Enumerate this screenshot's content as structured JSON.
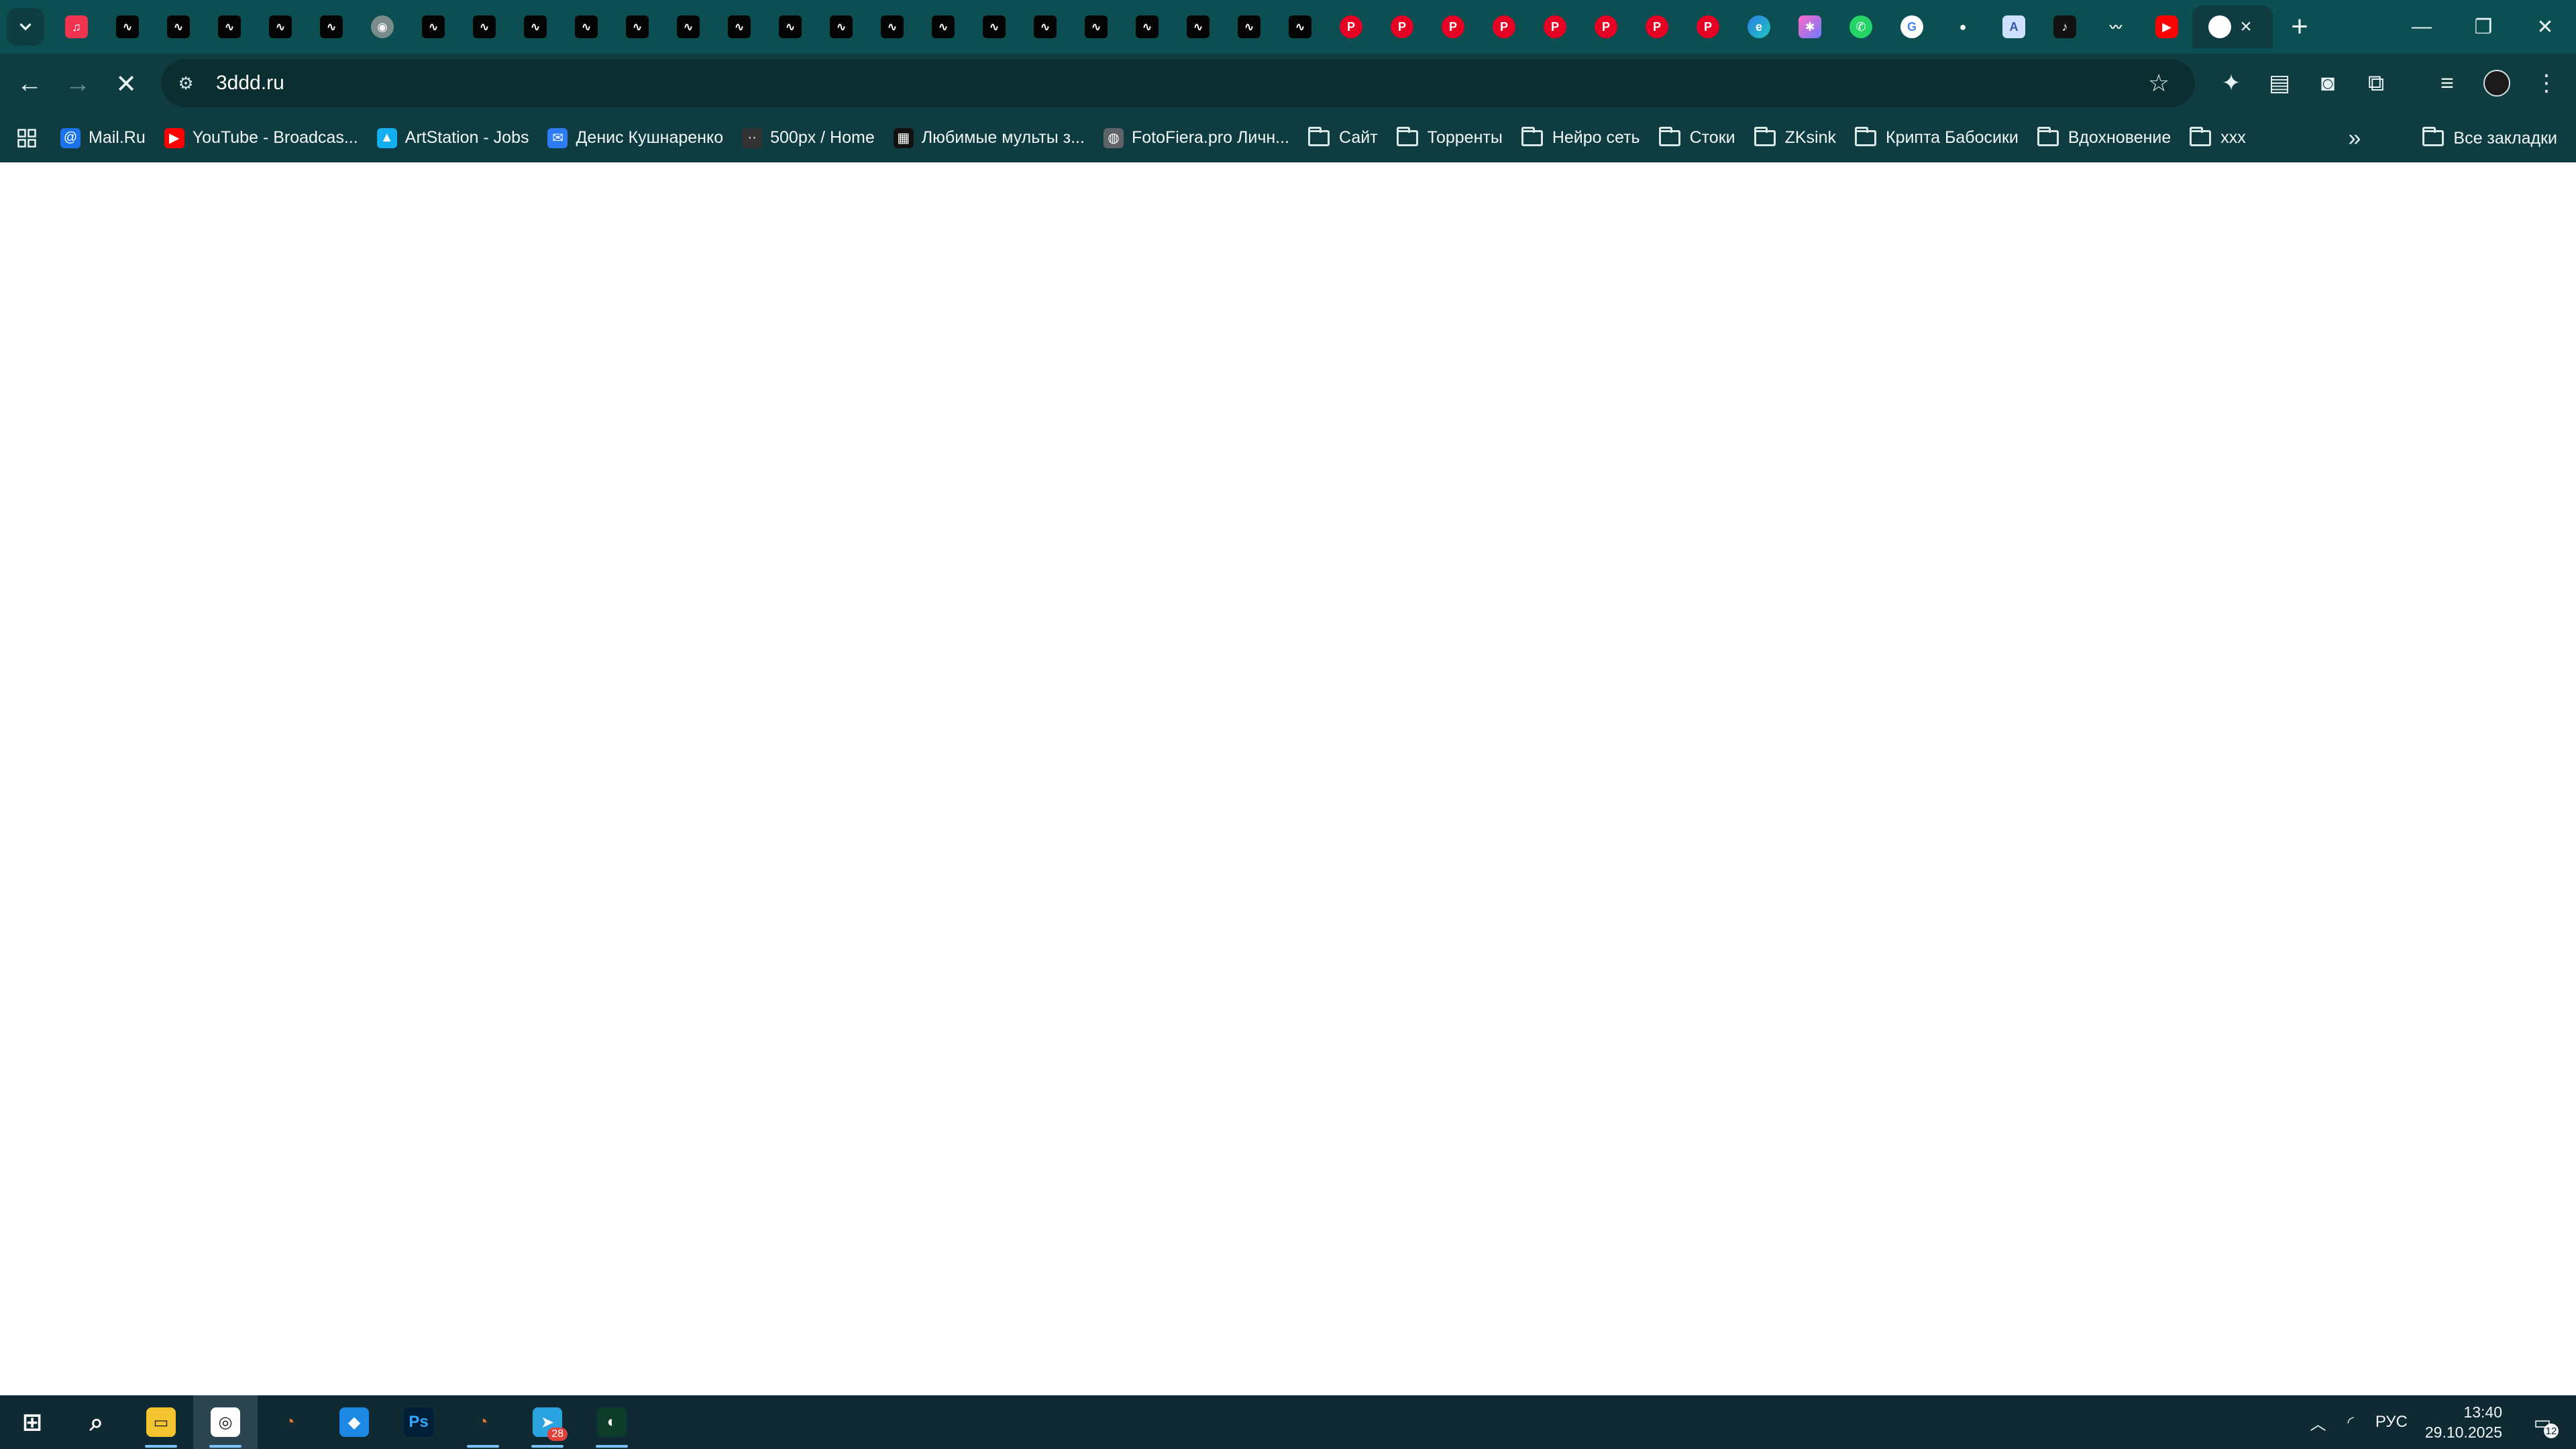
{
  "browser": {
    "tabs": [
      {
        "icon": "music-icon",
        "style": "music",
        "glyph": "♫"
      },
      {
        "icon": "site-icon",
        "style": "black",
        "glyph": "∿"
      },
      {
        "icon": "site-icon",
        "style": "black",
        "glyph": "∿"
      },
      {
        "icon": "site-icon",
        "style": "black",
        "glyph": "∿"
      },
      {
        "icon": "site-icon",
        "style": "black",
        "glyph": "∿"
      },
      {
        "icon": "site-icon",
        "style": "black",
        "glyph": "∿"
      },
      {
        "icon": "globe-icon",
        "style": "gray",
        "glyph": "◉"
      },
      {
        "icon": "site-icon",
        "style": "black",
        "glyph": "∿"
      },
      {
        "icon": "site-icon",
        "style": "black",
        "glyph": "∿"
      },
      {
        "icon": "site-icon",
        "style": "black",
        "glyph": "∿"
      },
      {
        "icon": "site-icon",
        "style": "black",
        "glyph": "∿"
      },
      {
        "icon": "site-icon",
        "style": "black",
        "glyph": "∿"
      },
      {
        "icon": "site-icon",
        "style": "black",
        "glyph": "∿"
      },
      {
        "icon": "site-icon",
        "style": "black",
        "glyph": "∿"
      },
      {
        "icon": "site-icon",
        "style": "black",
        "glyph": "∿"
      },
      {
        "icon": "site-icon",
        "style": "black",
        "glyph": "∿"
      },
      {
        "icon": "site-icon",
        "style": "black",
        "glyph": "∿"
      },
      {
        "icon": "site-icon",
        "style": "black",
        "glyph": "∿"
      },
      {
        "icon": "site-icon",
        "style": "black",
        "glyph": "∿"
      },
      {
        "icon": "site-icon",
        "style": "black",
        "glyph": "∿"
      },
      {
        "icon": "site-icon",
        "style": "black",
        "glyph": "∿"
      },
      {
        "icon": "site-icon",
        "style": "black",
        "glyph": "∿"
      },
      {
        "icon": "site-icon",
        "style": "black",
        "glyph": "∿"
      },
      {
        "icon": "site-icon",
        "style": "black",
        "glyph": "∿"
      },
      {
        "icon": "site-icon",
        "style": "black",
        "glyph": "∿"
      },
      {
        "icon": "pinterest-icon",
        "style": "pin",
        "glyph": "P"
      },
      {
        "icon": "pinterest-icon",
        "style": "pin",
        "glyph": "P"
      },
      {
        "icon": "pinterest-icon",
        "style": "pin",
        "glyph": "P"
      },
      {
        "icon": "pinterest-icon",
        "style": "pin",
        "glyph": "P"
      },
      {
        "icon": "pinterest-icon",
        "style": "pin",
        "glyph": "P"
      },
      {
        "icon": "pinterest-icon",
        "style": "pin",
        "glyph": "P"
      },
      {
        "icon": "pinterest-icon",
        "style": "pin",
        "glyph": "P"
      },
      {
        "icon": "pinterest-icon",
        "style": "pin",
        "glyph": "P"
      },
      {
        "icon": "edge-icon",
        "style": "edge",
        "glyph": "e"
      },
      {
        "icon": "app-icon",
        "style": "star",
        "glyph": "✱"
      },
      {
        "icon": "whatsapp-icon",
        "style": "wa",
        "glyph": "✆"
      },
      {
        "icon": "google-icon",
        "style": "g",
        "glyph": "G"
      },
      {
        "icon": "dots-icon",
        "style": "multi",
        "glyph": "●"
      },
      {
        "icon": "document-icon",
        "style": "doc",
        "glyph": "A"
      },
      {
        "icon": "tiktok-icon",
        "style": "tiktok",
        "glyph": "♪"
      },
      {
        "icon": "chart-icon",
        "style": "multi",
        "glyph": "〰"
      },
      {
        "icon": "youtube-icon",
        "style": "yt",
        "glyph": "▶"
      },
      {
        "icon": "chrome-icon",
        "style": "chrome",
        "glyph": "◎",
        "active": true
      }
    ],
    "url": "3ddd.ru",
    "bookmarks": [
      {
        "type": "link",
        "label": "Mail.Ru",
        "icon": "mailru-icon",
        "color": "#1a73e8",
        "glyph": "@"
      },
      {
        "type": "link",
        "label": "YouTube - Broadcas...",
        "icon": "youtube-icon",
        "color": "#ff0000",
        "glyph": "▶"
      },
      {
        "type": "link",
        "label": "ArtStation - Jobs",
        "icon": "artstation-icon",
        "color": "#13aff0",
        "glyph": "▲"
      },
      {
        "type": "link",
        "label": "Денис Кушнаренко",
        "icon": "chat-icon",
        "color": "#2d7cf6",
        "glyph": "✉"
      },
      {
        "type": "link",
        "label": "500px / Home",
        "icon": "500px-icon",
        "color": "#333333",
        "glyph": "··"
      },
      {
        "type": "link",
        "label": "Любимые мульты з...",
        "icon": "cartoon-icon",
        "color": "#111111",
        "glyph": "▦"
      },
      {
        "type": "link",
        "label": "FotoFiera.pro Личн...",
        "icon": "globe-icon",
        "color": "#5f6368",
        "glyph": "◍"
      },
      {
        "type": "folder",
        "label": "Сайт"
      },
      {
        "type": "folder",
        "label": "Торренты"
      },
      {
        "type": "folder",
        "label": "Нейро сеть"
      },
      {
        "type": "folder",
        "label": "Стоки"
      },
      {
        "type": "folder",
        "label": "ZKsink"
      },
      {
        "type": "folder",
        "label": "Крипта Бабосики"
      },
      {
        "type": "folder",
        "label": "Вдохновение"
      },
      {
        "type": "folder",
        "label": "xxx"
      }
    ],
    "all_bookmarks": "Все закладки"
  },
  "taskbar": {
    "apps": [
      {
        "icon": "windows-start-icon",
        "bg": "transparent",
        "glyph": "⊞"
      },
      {
        "icon": "search-icon",
        "bg": "transparent",
        "glyph": "⌕"
      },
      {
        "icon": "file-explorer-icon",
        "bg": "#f4c430",
        "glyph": "▭",
        "underline": true
      },
      {
        "icon": "chrome-icon",
        "bg": "#ffffff",
        "glyph": "◎",
        "active": true,
        "underline": true
      },
      {
        "icon": "blender-icon",
        "bg": "transparent",
        "glyph": "◔"
      },
      {
        "icon": "app-diamond-icon",
        "bg": "#1e88e5",
        "glyph": "◆"
      },
      {
        "icon": "photoshop-icon",
        "bg": "#001e36",
        "glyph": "Ps"
      },
      {
        "icon": "blender-icon",
        "bg": "transparent",
        "glyph": "◔",
        "underline": true
      },
      {
        "icon": "telegram-icon",
        "bg": "#2aa3e0",
        "glyph": "➤",
        "badge": "28",
        "underline": true
      },
      {
        "icon": "app-green-icon",
        "bg": "#0d3b2a",
        "glyph": "◐",
        "underline": true
      }
    ],
    "tray": {
      "language": "РУС",
      "time": "13:40",
      "date": "29.10.2025",
      "notifications": "12"
    }
  }
}
